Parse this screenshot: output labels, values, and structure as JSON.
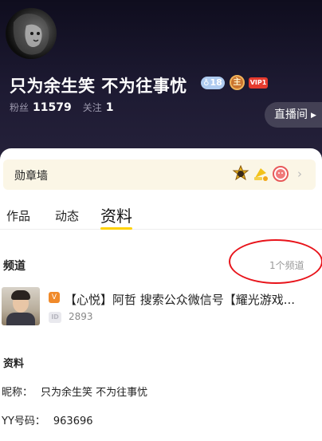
{
  "profile": {
    "nickname": "只为余生笑 不为往事忧",
    "level_badge_prefix": "♁",
    "level": "18",
    "host_badge": "主",
    "vip_badge": "VIP1",
    "fans_label": "粉丝",
    "fans_count": "11579",
    "follow_label": "关注",
    "follow_count": "1",
    "live_room_label": "直播间",
    "live_room_arrow": "▶"
  },
  "medal_wall": {
    "title": "勋章墙",
    "medals": [
      "gold-star-medal-icon",
      "trophy-medal-icon",
      "red-face-medal-icon"
    ],
    "chevron": "›"
  },
  "tabs": [
    {
      "label": "作品"
    },
    {
      "label": "动态"
    },
    {
      "label": "资料",
      "active": true
    }
  ],
  "channels": {
    "section_title": "频道",
    "count_label": "1个频道",
    "items": [
      {
        "tag": "V",
        "name": "【心悦】阿哲   搜索公众微信号【耀光游戏...",
        "id_badge": "ID",
        "id": "2893"
      }
    ]
  },
  "info": {
    "section_title": "资料",
    "rows": [
      {
        "label": "昵称：",
        "value": "只为余生笑 不为往事忧"
      },
      {
        "label": "YY号码：",
        "value": "963696"
      }
    ]
  },
  "colors": {
    "header_bg": "#1a1730",
    "accent_yellow": "#ffd200",
    "vip_red": "#e63b2e",
    "annotation_red": "#e8141b"
  }
}
